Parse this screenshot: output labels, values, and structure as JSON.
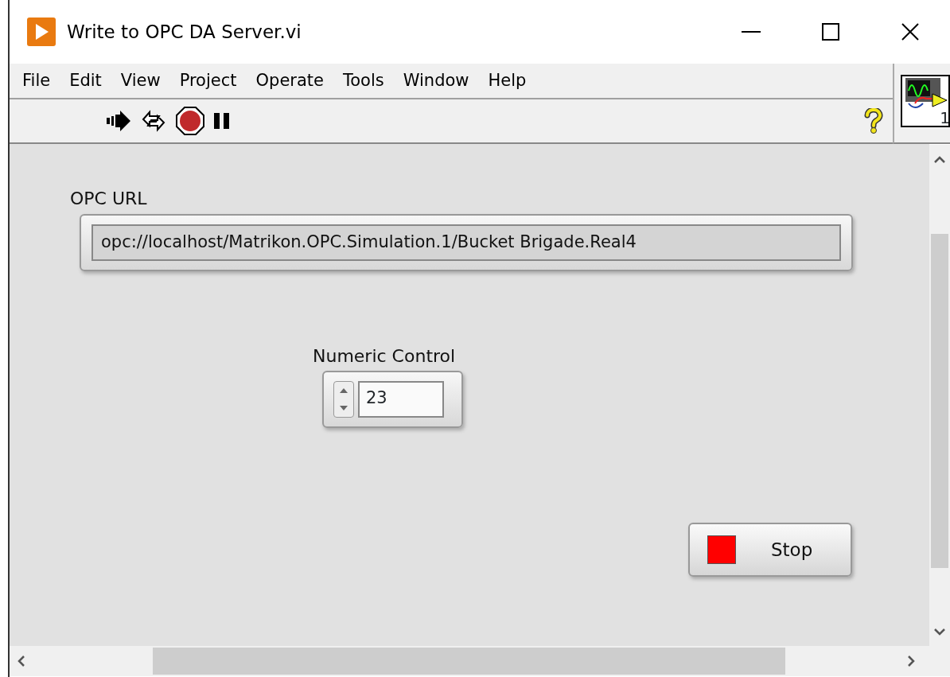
{
  "window": {
    "title": "Write to OPC DA Server.vi"
  },
  "menu": [
    "File",
    "Edit",
    "View",
    "Project",
    "Operate",
    "Tools",
    "Window",
    "Help"
  ],
  "vi_icon_label": "1",
  "panel": [
    {
      "kind": "string",
      "label": "OPC URL",
      "value": "opc://localhost/Matrikon.OPC.Simulation.1/Bucket Brigade.Real4"
    },
    {
      "kind": "numeric",
      "label": "Numeric Control",
      "value": "23"
    },
    {
      "kind": "button",
      "label": "Stop",
      "on": false
    }
  ]
}
